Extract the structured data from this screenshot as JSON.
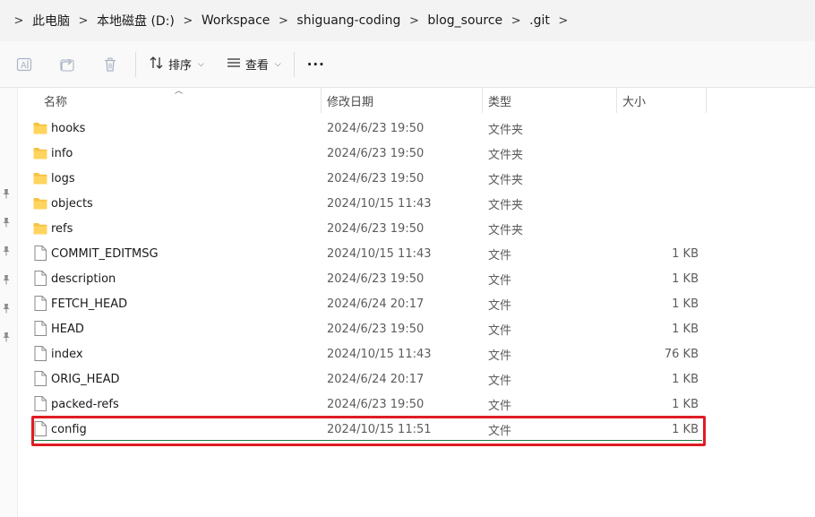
{
  "breadcrumb": [
    "此电脑",
    "本地磁盘 (D:)",
    "Workspace",
    "shiguang-coding",
    "blog_source",
    ".git"
  ],
  "toolbar": {
    "sort_label": "排序",
    "view_label": "查看",
    "more_label": "···"
  },
  "columns": {
    "name": "名称",
    "date": "修改日期",
    "type": "类型",
    "size": "大小"
  },
  "files": [
    {
      "name": "hooks",
      "date": "2024/6/23 19:50",
      "type": "文件夹",
      "size": "",
      "icon": "folder-icon"
    },
    {
      "name": "info",
      "date": "2024/6/23 19:50",
      "type": "文件夹",
      "size": "",
      "icon": "folder-icon"
    },
    {
      "name": "logs",
      "date": "2024/6/23 19:50",
      "type": "文件夹",
      "size": "",
      "icon": "folder-icon"
    },
    {
      "name": "objects",
      "date": "2024/10/15 11:43",
      "type": "文件夹",
      "size": "",
      "icon": "folder-icon"
    },
    {
      "name": "refs",
      "date": "2024/6/23 19:50",
      "type": "文件夹",
      "size": "",
      "icon": "folder-icon"
    },
    {
      "name": "COMMIT_EDITMSG",
      "date": "2024/10/15 11:43",
      "type": "文件",
      "size": "1 KB",
      "icon": "file-icon"
    },
    {
      "name": "description",
      "date": "2024/6/23 19:50",
      "type": "文件",
      "size": "1 KB",
      "icon": "file-icon"
    },
    {
      "name": "FETCH_HEAD",
      "date": "2024/6/24 20:17",
      "type": "文件",
      "size": "1 KB",
      "icon": "file-icon"
    },
    {
      "name": "HEAD",
      "date": "2024/6/23 19:50",
      "type": "文件",
      "size": "1 KB",
      "icon": "file-icon"
    },
    {
      "name": "index",
      "date": "2024/10/15 11:43",
      "type": "文件",
      "size": "76 KB",
      "icon": "file-icon"
    },
    {
      "name": "ORIG_HEAD",
      "date": "2024/6/24 20:17",
      "type": "文件",
      "size": "1 KB",
      "icon": "file-icon"
    },
    {
      "name": "packed-refs",
      "date": "2024/6/23 19:50",
      "type": "文件",
      "size": "1 KB",
      "icon": "file-icon"
    },
    {
      "name": "config",
      "date": "2024/10/15 11:51",
      "type": "文件",
      "size": "1 KB",
      "icon": "file-icon",
      "highlighted": true
    }
  ],
  "colors": {
    "folder": "#f6c342",
    "highlight": "#e01c24"
  }
}
